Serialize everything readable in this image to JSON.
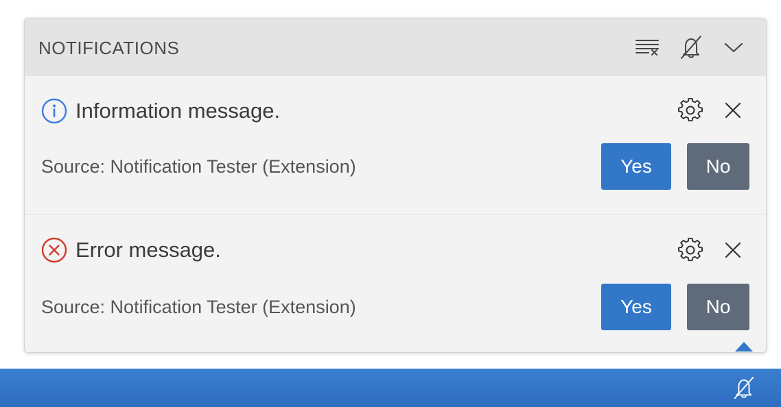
{
  "panel": {
    "title": "NOTIFICATIONS",
    "header_actions": [
      "clear-all-icon",
      "bell-slash-icon",
      "chevron-down-icon"
    ]
  },
  "notifications": [
    {
      "severity": "info",
      "icon": "info-icon",
      "icon_color": "#3b7ddd",
      "message": "Information message.",
      "source": "Source: Notification Tester (Extension)",
      "actions": [
        "Yes",
        "No"
      ]
    },
    {
      "severity": "error",
      "icon": "error-icon",
      "icon_color": "#d1392c",
      "message": "Error message.",
      "source": "Source: Notification Tester (Extension)",
      "actions": [
        "Yes",
        "No"
      ]
    }
  ],
  "statusbar": {
    "color": "#3277c8",
    "icon": "bell-slash-icon"
  },
  "colors": {
    "primary_button": "#3277c8",
    "secondary_button": "#5f6a7a"
  }
}
